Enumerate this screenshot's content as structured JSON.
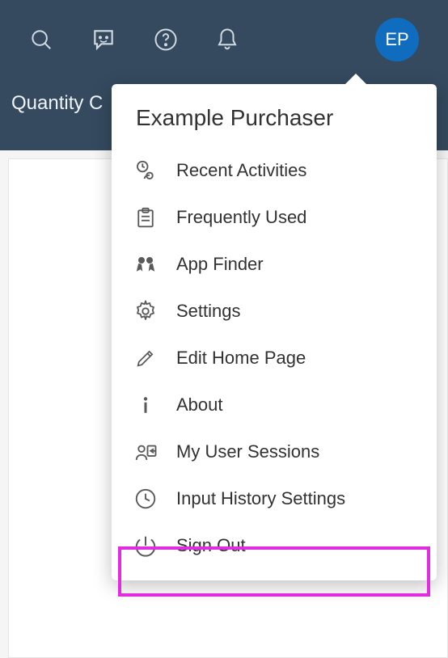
{
  "header": {
    "sub_title": "Quantity C"
  },
  "avatar": {
    "initials": "EP"
  },
  "popover": {
    "title": "Example Purchaser",
    "items": [
      {
        "icon": "recent-activities-icon",
        "label": "Recent Activities"
      },
      {
        "icon": "frequently-used-icon",
        "label": "Frequently Used"
      },
      {
        "icon": "app-finder-icon",
        "label": "App Finder"
      },
      {
        "icon": "settings-icon",
        "label": "Settings"
      },
      {
        "icon": "edit-icon",
        "label": "Edit Home Page"
      },
      {
        "icon": "about-icon",
        "label": "About"
      },
      {
        "icon": "user-sessions-icon",
        "label": "My User Sessions"
      },
      {
        "icon": "input-history-icon",
        "label": "Input History Settings"
      },
      {
        "icon": "sign-out-icon",
        "label": "Sign Out"
      }
    ]
  },
  "colors": {
    "header_bg": "#354a5f",
    "avatar_bg": "#0f6cbf",
    "highlight": "#e22ce0"
  }
}
